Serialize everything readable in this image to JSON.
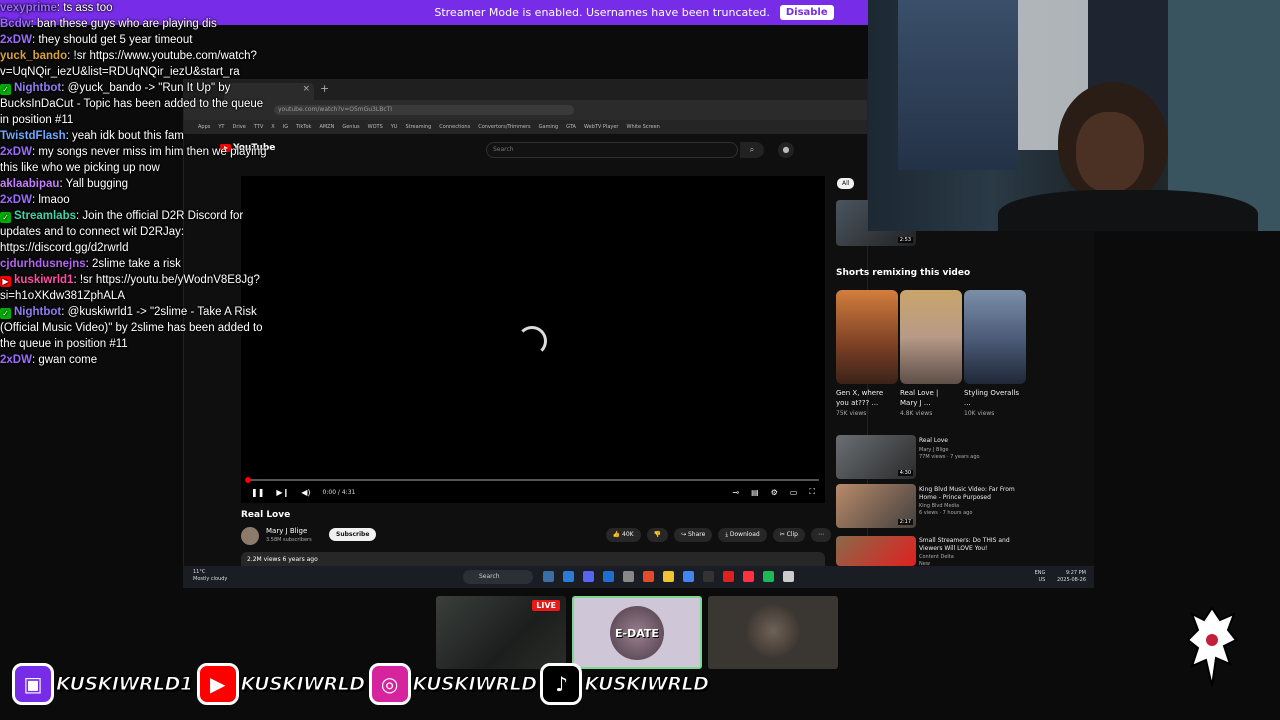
{
  "banner": {
    "text": "Streamer Mode is enabled. Usernames have been truncated.",
    "button": "Disable"
  },
  "chat": [
    {
      "user": "vexyprime",
      "color": "#9b6bff",
      "badge": "",
      "msg": ": ts ass too"
    },
    {
      "user": "Bcdw",
      "color": "#9b6bff",
      "badge": "",
      "msg": ": ban these guys who are playing dis"
    },
    {
      "user": "2xDW",
      "color": "#9b6bff",
      "badge": "",
      "msg": ": they should get 5 year timeout"
    },
    {
      "user": "yuck_bando",
      "color": "#d9a13b",
      "badge": "",
      "msg": ": !sr https://www.youtube.com/watch?v=UqNQir_iezU&list=RDUqNQir_iezU&start_ra"
    },
    {
      "user": "Nightbot",
      "color": "#8e7cf0",
      "badge": "mod",
      "msg": ": @yuck_bando -> \"Run It Up\" by BucksInDaCut - Topic has been added to the queue in position #11"
    },
    {
      "user": "TwistdFlash",
      "color": "#6fa8ff",
      "badge": "",
      "msg": ": yeah idk bout this fam"
    },
    {
      "user": "2xDW",
      "color": "#9b6bff",
      "badge": "",
      "msg": ": my songs never miss im him then we playing this like who we picking up now"
    },
    {
      "user": "aklaabipau",
      "color": "#c77dff",
      "badge": "",
      "msg": ": Yall bugging"
    },
    {
      "user": "2xDW",
      "color": "#9b6bff",
      "badge": "",
      "msg": ": lmaoo"
    },
    {
      "user": "Streamlabs",
      "color": "#3fd3a5",
      "badge": "mod",
      "msg": ": Join the official D2R Discord for updates and to connect wit D2RJay: https://discord.gg/d2rwrld"
    },
    {
      "user": "cjdurhdusnejns",
      "color": "#b563f2",
      "badge": "",
      "msg": ": 2slime take a risk"
    },
    {
      "user": "kuskiwrld1",
      "color": "#ff4fa3",
      "badge": "yt",
      "msg": ": !sr https://youtu.be/yWodnV8E8Jg?si=h1oXKdw381ZphALA"
    },
    {
      "user": "Nightbot",
      "color": "#8e7cf0",
      "badge": "mod",
      "msg": ": @kuskiwrld1 -> \"2slime - Take A Risk (Official Music Video)\" by 2slime has been added to the queue in position #11"
    },
    {
      "user": "2xDW",
      "color": "#9b6bff",
      "badge": "",
      "msg": ": gwan come"
    }
  ],
  "browser": {
    "url": "youtube.com/watch?v=O5mGu3LBcTI",
    "bookmarks": [
      "Apps",
      "YT",
      "Drive",
      "TTV",
      "X",
      "IG",
      "TikTok",
      "AMZN",
      "Genius",
      "WOTS",
      "YU",
      "Streaming",
      "Connections",
      "Convertors/Trimmers",
      "Gaming",
      "GTA",
      "WebTV Player",
      "White Screen"
    ]
  },
  "youtube": {
    "logo": "YouTube",
    "search_placeholder": "Search",
    "time": "0:00 / 4:31",
    "title": "Real Love",
    "channel": "Mary J Blige",
    "subs": "3.58M subscribers",
    "subscribe": "Subscribe",
    "likes": "40K",
    "share": "Share",
    "download": "Download",
    "clip": "Clip",
    "views": "2.2M views  6 years ago",
    "chip_all": "All",
    "shorts_title": "Shorts remixing this video",
    "shorts": [
      {
        "title": "Gen X, where you at??? ...",
        "views": "75K views"
      },
      {
        "title": "Real Love | Mary J ...",
        "views": "4.8K views"
      },
      {
        "title": "Styling Overalls ...",
        "views": "10K views"
      }
    ],
    "top_duration": "2:53",
    "recs": [
      {
        "title": "Real Love",
        "meta": "Mary J Blige\n77M views · 7 years ago",
        "dur": "4:30"
      },
      {
        "title": "King Blvd Music Video: Far From Home - Prince Purposed",
        "meta": "King Blvd Media\n6 views · 7 hours ago",
        "dur": "2:17"
      },
      {
        "title": "Small Streamers: Do THIS and Viewers Will LOVE You!",
        "meta": "Content Delta\nNew",
        "dur": ""
      }
    ]
  },
  "taskbar": {
    "weather": "11°C\nMostly cloudy",
    "search": "Search",
    "lang": "ENG\nUS",
    "clock": "9:27 PM\n2025-08-26"
  },
  "cards": {
    "live": "LIVE",
    "date_text": "E-DATE"
  },
  "socials": [
    {
      "platform": "twitch",
      "name": "KUSKIWRLD1",
      "color": "#772ce8"
    },
    {
      "platform": "youtube",
      "name": "KUSKIWRLD",
      "color": "#ff0000"
    },
    {
      "platform": "instagram",
      "name": "KUSKIWRLD",
      "color": "#d6249f"
    },
    {
      "platform": "tiktok",
      "name": "KUSKIWRLD",
      "color": "#000000"
    }
  ]
}
